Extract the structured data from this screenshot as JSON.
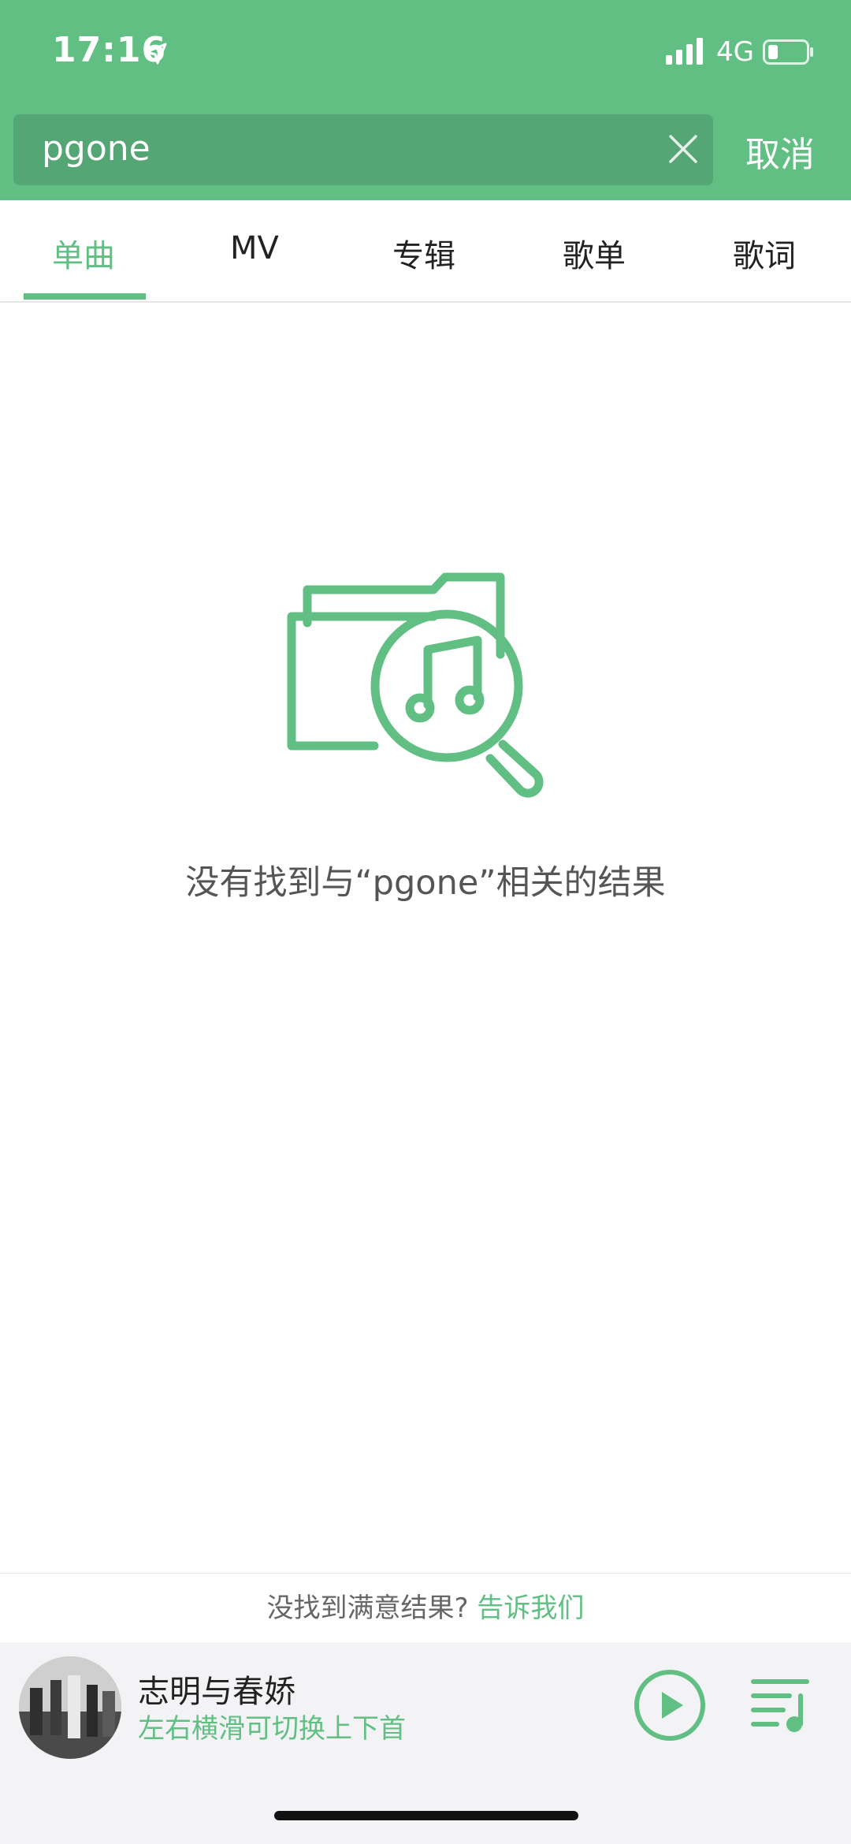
{
  "status_bar": {
    "time": "17:16",
    "network": "4G"
  },
  "search": {
    "query": "pgone",
    "cancel_label": "取消"
  },
  "tabs": [
    {
      "label": "单曲",
      "active": true
    },
    {
      "label": "MV",
      "active": false
    },
    {
      "label": "专辑",
      "active": false
    },
    {
      "label": "歌单",
      "active": false
    },
    {
      "label": "歌词",
      "active": false
    }
  ],
  "empty_state": {
    "message": "没有找到与“pgone”相关的结果",
    "icon": "folder-music-search-icon"
  },
  "feedback": {
    "prompt": "没找到满意结果?",
    "link": "告诉我们"
  },
  "player": {
    "title": "志明与春娇",
    "subtitle": "左右横滑可切换上下首"
  },
  "colors": {
    "accent": "#62bf83",
    "search_bg": "#54a674",
    "player_bg": "#f3f3f5"
  }
}
